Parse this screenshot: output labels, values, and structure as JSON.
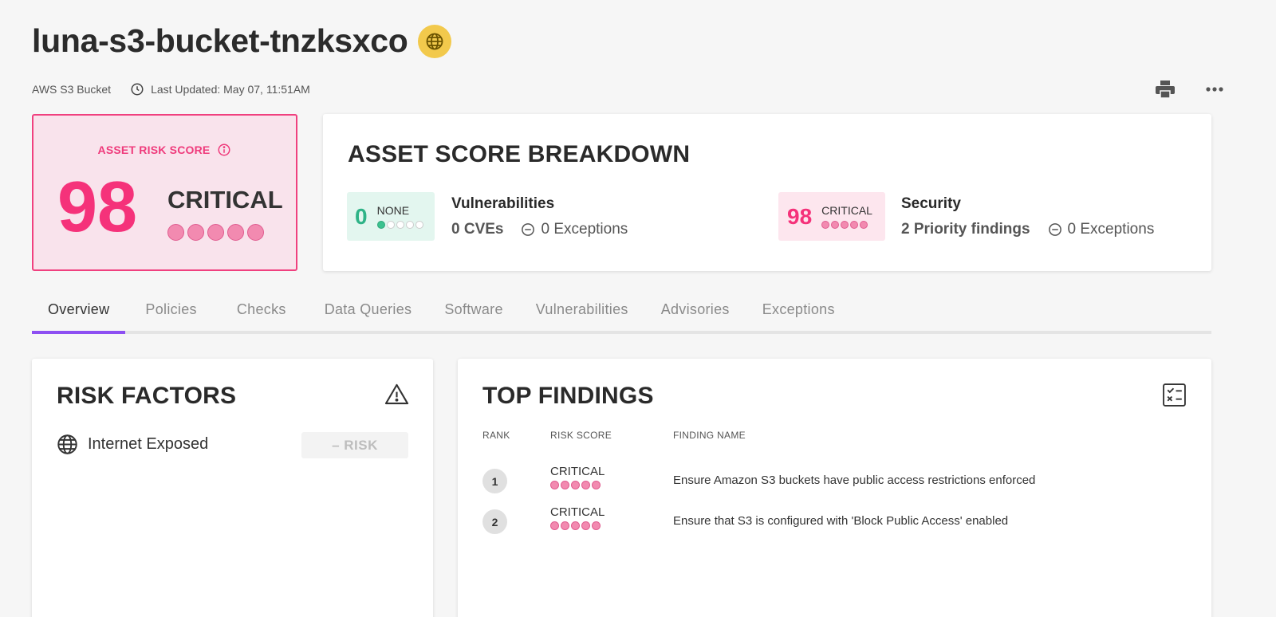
{
  "asset": {
    "title": "luna-s3-bucket-tnzksxco",
    "type": "AWS S3 Bucket",
    "last_updated": "Last Updated: May 07, 11:51AM"
  },
  "risk_score": {
    "label": "ASSET RISK SCORE",
    "value": "98",
    "severity": "CRITICAL",
    "severity_dots_filled": 5
  },
  "breakdown": {
    "title": "ASSET SCORE BREAKDOWN",
    "vulnerabilities": {
      "score": "0",
      "level": "NONE",
      "title": "Vulnerabilities",
      "count": "0 CVEs",
      "exceptions": "0 Exceptions"
    },
    "security": {
      "score": "98",
      "level": "CRITICAL",
      "title": "Security",
      "count": "2 Priority findings",
      "exceptions": "0 Exceptions"
    }
  },
  "tabs": [
    "Overview",
    "Policies",
    "Checks",
    "Data Queries",
    "Software",
    "Vulnerabilities",
    "Advisories",
    "Exceptions"
  ],
  "risk_factors": {
    "title": "RISK FACTORS",
    "items": [
      {
        "label": "Internet Exposed",
        "badge": "– RISK"
      }
    ]
  },
  "top_findings": {
    "title": "TOP FINDINGS",
    "columns": {
      "rank": "RANK",
      "risk_score": "RISK SCORE",
      "finding_name": "FINDING NAME"
    },
    "rows": [
      {
        "rank": "1",
        "risk": "CRITICAL",
        "name": "Ensure Amazon S3 buckets have public access restrictions enforced"
      },
      {
        "rank": "2",
        "risk": "CRITICAL",
        "name": "Ensure that S3 is configured with 'Block Public Access' enabled"
      }
    ]
  },
  "colors": {
    "critical": "#f5327a",
    "none": "#2fb387",
    "tab_accent": "#8d4ff2",
    "globe_badge": "#f2c94c"
  }
}
